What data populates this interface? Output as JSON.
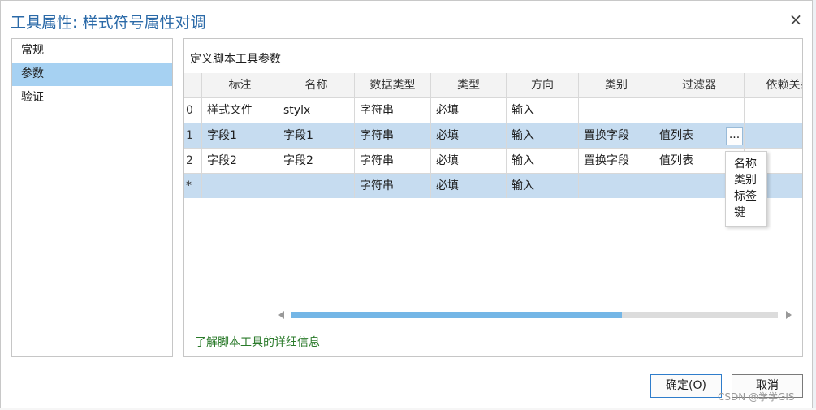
{
  "dialog": {
    "title": "工具属性: 样式符号属性对调",
    "close_glyph": "×"
  },
  "nav": {
    "items": [
      {
        "label": "常规",
        "active": false
      },
      {
        "label": "参数",
        "active": true
      },
      {
        "label": "验证",
        "active": false
      }
    ]
  },
  "panel": {
    "header": "定义脚本工具参数",
    "columns": [
      "标注",
      "名称",
      "数据类型",
      "类型",
      "方向",
      "类别",
      "过滤器",
      "依赖关系"
    ],
    "rows": [
      {
        "index": "0",
        "cells": [
          "样式文件",
          "stylx",
          "字符串",
          "必填",
          "输入",
          "",
          "",
          ""
        ]
      },
      {
        "index": "1",
        "cells": [
          "字段1",
          "字段1",
          "字符串",
          "必填",
          "输入",
          "置换字段",
          "值列表",
          ""
        ]
      },
      {
        "index": "2",
        "cells": [
          "字段2",
          "字段2",
          "字符串",
          "必填",
          "输入",
          "置换字段",
          "值列表",
          ""
        ]
      },
      {
        "index": "*",
        "cells": [
          "",
          "",
          "字符串",
          "必填",
          "输入",
          "",
          "",
          ""
        ]
      }
    ],
    "filter_button_label": "...",
    "scroll_fraction": 0.68,
    "learn_more_link": "了解脚本工具的详细信息"
  },
  "popup_menu": {
    "items": [
      "名称",
      "类别",
      "标签",
      "键"
    ]
  },
  "buttons": {
    "ok": "确定(O)",
    "cancel": "取消"
  },
  "watermark": "CSDN @学学GIS",
  "colors": {
    "title": "#2b6aa8",
    "nav_active": "#a6d1f2",
    "row_selected": "#c6dcf0",
    "scroll_thumb": "#74b6e6",
    "link": "#2a7a2a"
  }
}
